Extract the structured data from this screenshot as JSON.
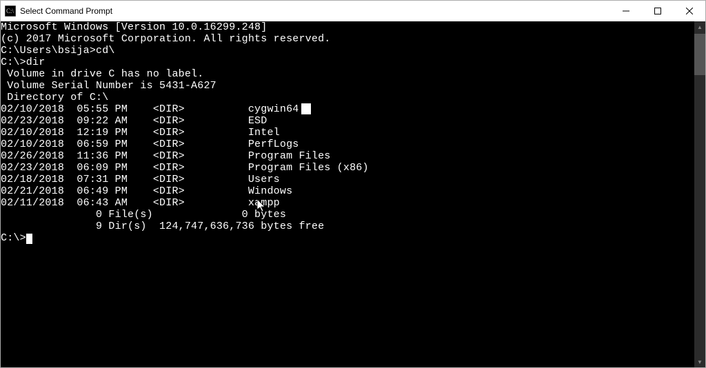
{
  "window": {
    "title": "Select Command Prompt"
  },
  "terminal": {
    "banner1": "Microsoft Windows [Version 10.0.16299.248]",
    "banner2": "(c) 2017 Microsoft Corporation. All rights reserved.",
    "prompt1": "C:\\Users\\bsija>cd\\",
    "prompt2": "C:\\>dir",
    "volLine1": " Volume in drive C has no label.",
    "volLine2": " Volume Serial Number is 5431-A627",
    "dirOf": " Directory of C:\\",
    "entries": [
      {
        "date": "02/10/2018",
        "time": "05:55 PM",
        "type": "<DIR>",
        "name": "cygwin64",
        "hasSelection": true
      },
      {
        "date": "02/23/2018",
        "time": "09:22 AM",
        "type": "<DIR>",
        "name": "ESD"
      },
      {
        "date": "02/10/2018",
        "time": "12:19 PM",
        "type": "<DIR>",
        "name": "Intel"
      },
      {
        "date": "02/10/2018",
        "time": "06:59 PM",
        "type": "<DIR>",
        "name": "PerfLogs"
      },
      {
        "date": "02/26/2018",
        "time": "11:36 PM",
        "type": "<DIR>",
        "name": "Program Files"
      },
      {
        "date": "02/23/2018",
        "time": "06:09 PM",
        "type": "<DIR>",
        "name": "Program Files (x86)"
      },
      {
        "date": "02/18/2018",
        "time": "07:31 PM",
        "type": "<DIR>",
        "name": "Users"
      },
      {
        "date": "02/21/2018",
        "time": "06:49 PM",
        "type": "<DIR>",
        "name": "Windows"
      },
      {
        "date": "02/11/2018",
        "time": "06:43 AM",
        "type": "<DIR>",
        "name": "xampp"
      }
    ],
    "summary1": "               0 File(s)              0 bytes",
    "summary2": "               9 Dir(s)  124,747,636,736 bytes free",
    "prompt3": "C:\\>"
  }
}
